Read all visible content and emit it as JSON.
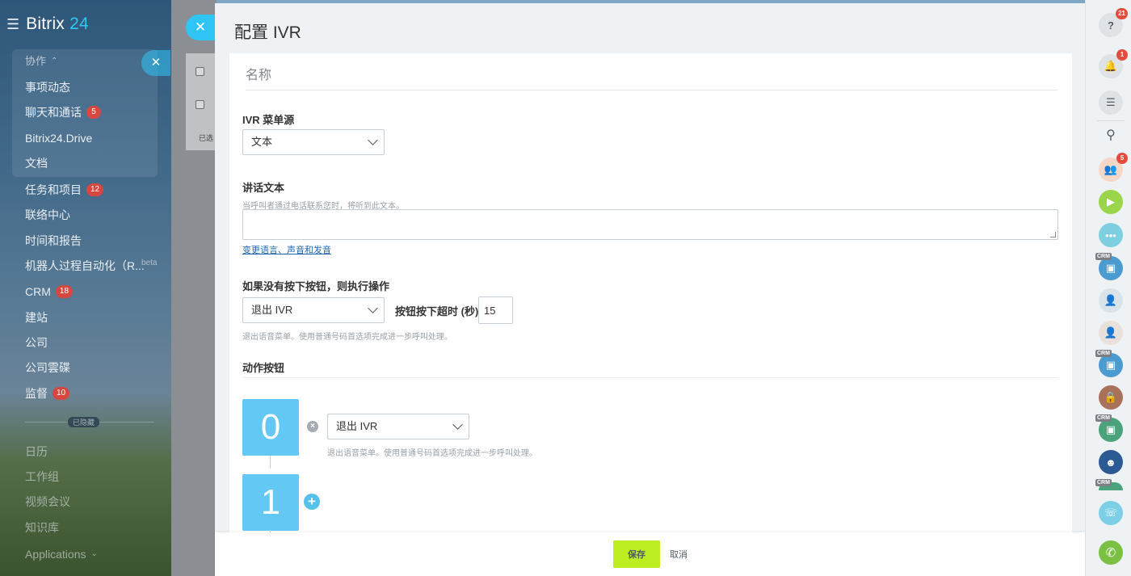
{
  "sidebar": {
    "logo_main": "Bitrix",
    "logo_num": "24",
    "group_title": "协作",
    "items": [
      {
        "label": "事项动态",
        "badge": ""
      },
      {
        "label": "聊天和通话",
        "badge": "5"
      },
      {
        "label": "Bitrix24.Drive",
        "badge": ""
      },
      {
        "label": "文档",
        "badge": ""
      },
      {
        "label": "任务和项目",
        "badge": "12"
      },
      {
        "label": "联络中心",
        "badge": ""
      },
      {
        "label": "时间和报告",
        "badge": ""
      },
      {
        "label": "机器人过程自动化（R...",
        "badge": ""
      },
      {
        "label": "CRM",
        "badge": "18"
      },
      {
        "label": "建站",
        "badge": ""
      },
      {
        "label": "公司",
        "badge": ""
      },
      {
        "label": "公司雲碟",
        "badge": ""
      },
      {
        "label": "监督",
        "badge": "10"
      }
    ],
    "beta_label": "beta",
    "hidden_label": "已隐藏",
    "hidden_items": [
      "日历",
      "工作组",
      "视频会议",
      "知识库",
      "Applications"
    ]
  },
  "underlying": {
    "selected_text": "已选"
  },
  "panel": {
    "title": "配置 IVR",
    "name_placeholder": "名称",
    "source_label": "IVR 菜单源",
    "source_value": "文本",
    "speech_label": "讲话文本",
    "speech_hint": "当呼叫者通过电话联系您时，将听到此文本。",
    "speech_value": "",
    "voice_link": "变更语言、声音和发音",
    "no_press_label": "如果没有按下按钮，则执行操作",
    "no_press_value": "退出 IVR",
    "timeout_label": "按钮按下超时 (秒):",
    "timeout_value": "15",
    "no_press_hint": "退出语音菜单。使用普通号码首选项完成进一步呼叫处理。",
    "buttons_label": "动作按钮",
    "buttons": [
      {
        "digit": "0",
        "action": "退出 IVR",
        "hint": "退出语音菜单。使用普通号码首选项完成进一步呼叫处理。"
      },
      {
        "digit": "1"
      }
    ]
  },
  "footer": {
    "save_label": "保存",
    "cancel_label": "取消"
  },
  "rightbar": {
    "help_badge": "21",
    "notify_badge": "1",
    "chat_badge": "5",
    "crm_tag": "CRM"
  },
  "colors": {
    "accent": "#2fc6f6",
    "save": "#bbed21",
    "digit": "#63c8f3",
    "badge": "#d8473f"
  }
}
